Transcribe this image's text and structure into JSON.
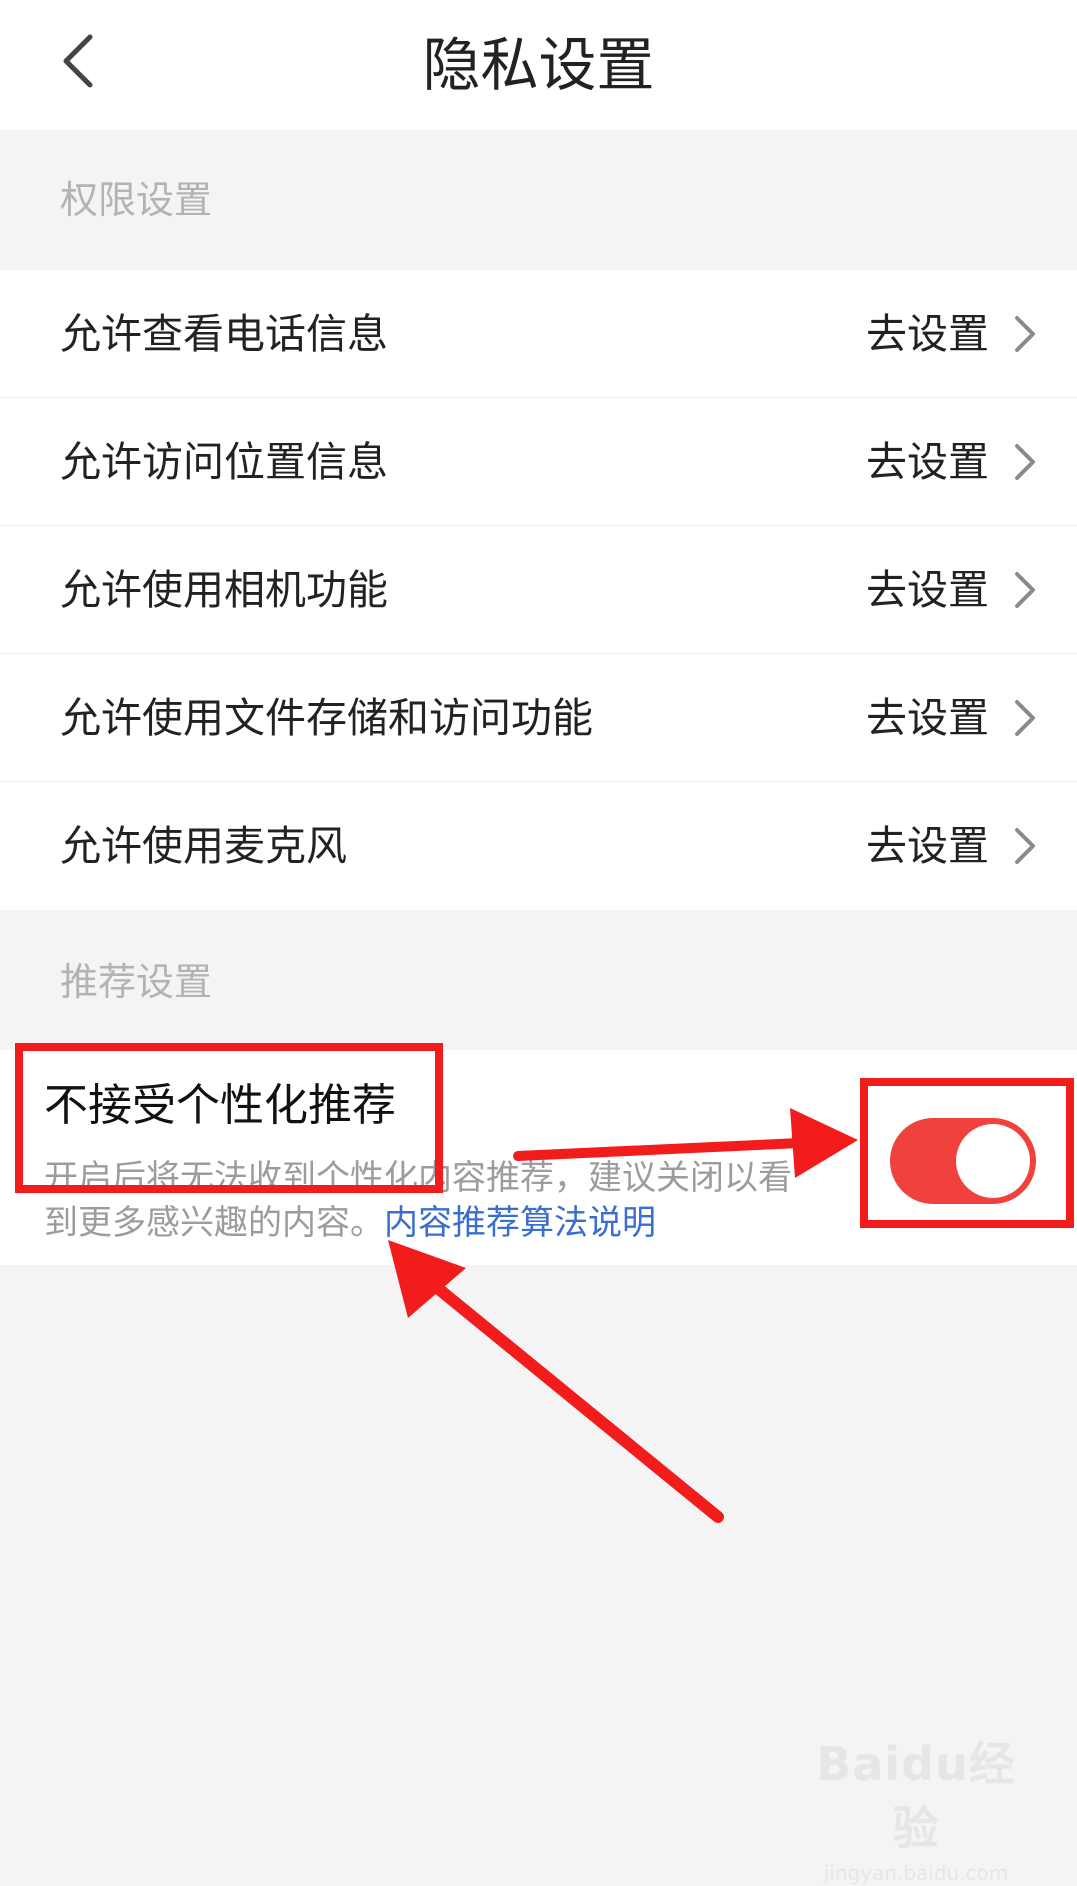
{
  "header": {
    "title": "隐私设置",
    "back_icon": "chevron-left-icon"
  },
  "permissions": {
    "section_title": "权限设置",
    "items": [
      {
        "label": "允许查看电话信息",
        "action": "去设置"
      },
      {
        "label": "允许访问位置信息",
        "action": "去设置"
      },
      {
        "label": "允许使用相机功能",
        "action": "去设置"
      },
      {
        "label": "允许使用文件存储和访问功能",
        "action": "去设置"
      },
      {
        "label": "允许使用麦克风",
        "action": "去设置"
      }
    ]
  },
  "recommendation": {
    "section_title": "推荐设置",
    "title": "不接受个性化推荐",
    "description": "开启后将无法收到个性化内容推荐，建议关闭以看到更多感兴趣的内容。",
    "link": "内容推荐算法说明",
    "toggle_on": true,
    "toggle_color": "#f0413d"
  },
  "annotations": {
    "highlight_color": "#f21c1c"
  },
  "watermark": {
    "main": "Baidu经验",
    "sub": "jingyan.baidu.com"
  }
}
